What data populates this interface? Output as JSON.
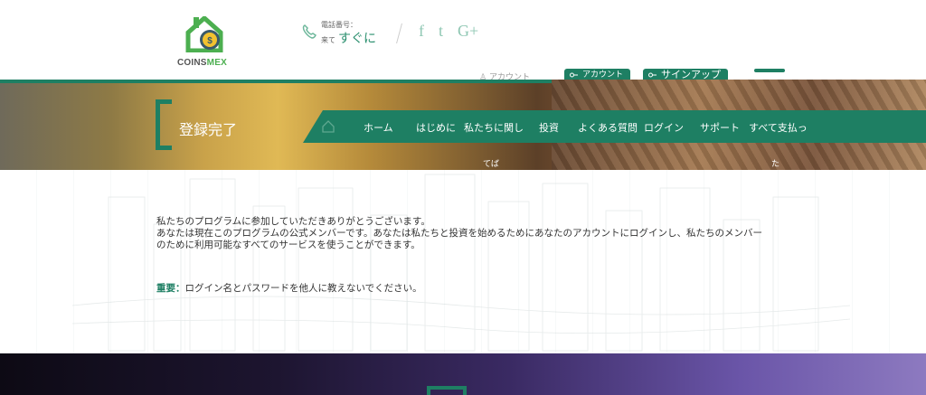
{
  "header": {
    "logo": {
      "text_part1": "COINS",
      "text_part2": "MEX",
      "icon": "house-coin-icon"
    },
    "phone": {
      "label": "電話番号：",
      "prefix": "来て",
      "value": "すぐに",
      "icon": "phone-icon"
    },
    "social": [
      {
        "name": "facebook-icon",
        "glyph": "f"
      },
      {
        "name": "twitter-icon",
        "glyph": "t"
      },
      {
        "name": "google-plus-icon",
        "glyph": "G+"
      }
    ],
    "account_link": "アカウント",
    "account_button": "アカウント",
    "signup_button": "サインアップ"
  },
  "banner": {
    "title": "登録完了",
    "nav": [
      "ホーム",
      "はじめに",
      "私たちに関し",
      "投資",
      "よくある質問",
      "ログイン",
      "サポート",
      "すべて支払っ"
    ],
    "sub_left": "てば",
    "sub_right": "た"
  },
  "content": {
    "message_line1": "私たちのプログラムに参加していただきありがとうございます。",
    "message_line2": "あなたは現在このプログラムの公式メンバーです。あなたは私たちと投資を始めるためにあなたのアカウントにログインし、私たちのメンバーのために利用可能なすべてのサービスを使うことができます。",
    "notice_label": "重要：",
    "notice_text": "ログイン名とパスワードを他人に教えないでください。"
  },
  "colors": {
    "accent": "#1e7f63",
    "accent_light": "#4caf50"
  }
}
